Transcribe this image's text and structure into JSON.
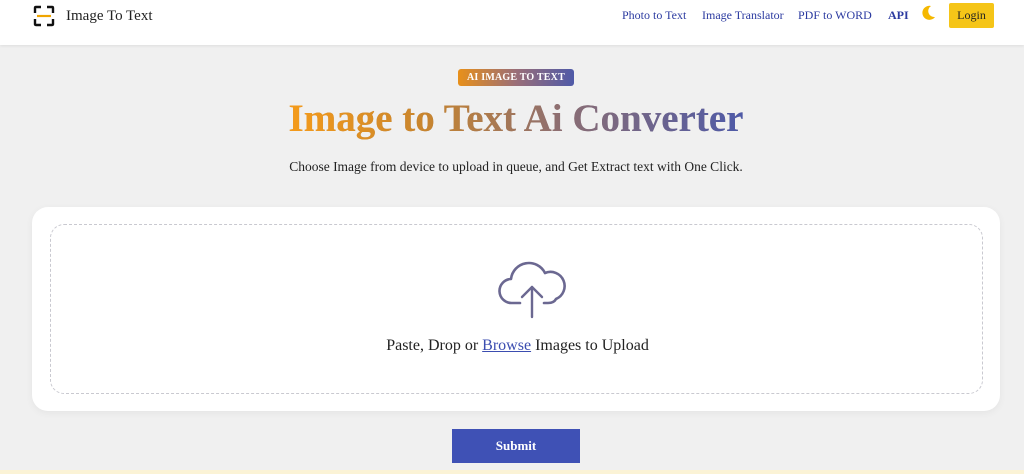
{
  "header": {
    "logo_text": "Image To Text",
    "nav": [
      {
        "label": "Photo to Text"
      },
      {
        "label": "Image Translator"
      },
      {
        "label": "PDF to WORD"
      },
      {
        "label": "API"
      }
    ],
    "login_label": "Login",
    "icons": {
      "logo": "scan-frame-icon",
      "theme": "moon-icon"
    }
  },
  "hero": {
    "badge": "AI IMAGE TO TEXT",
    "title": "Image to Text Ai Converter",
    "subtitle": "Choose Image from device to upload in queue, and Get Extract text with One Click."
  },
  "upload": {
    "text_before": "Paste, Drop or ",
    "browse_label": "Browse",
    "text_after": " Images to Upload",
    "icon": "cloud-upload-icon"
  },
  "submit_label": "Submit",
  "colors": {
    "accent": "#3f51b5",
    "login": "#f5c518",
    "gradient_start": "#f59b1a",
    "gradient_end": "#4e5aa8"
  }
}
